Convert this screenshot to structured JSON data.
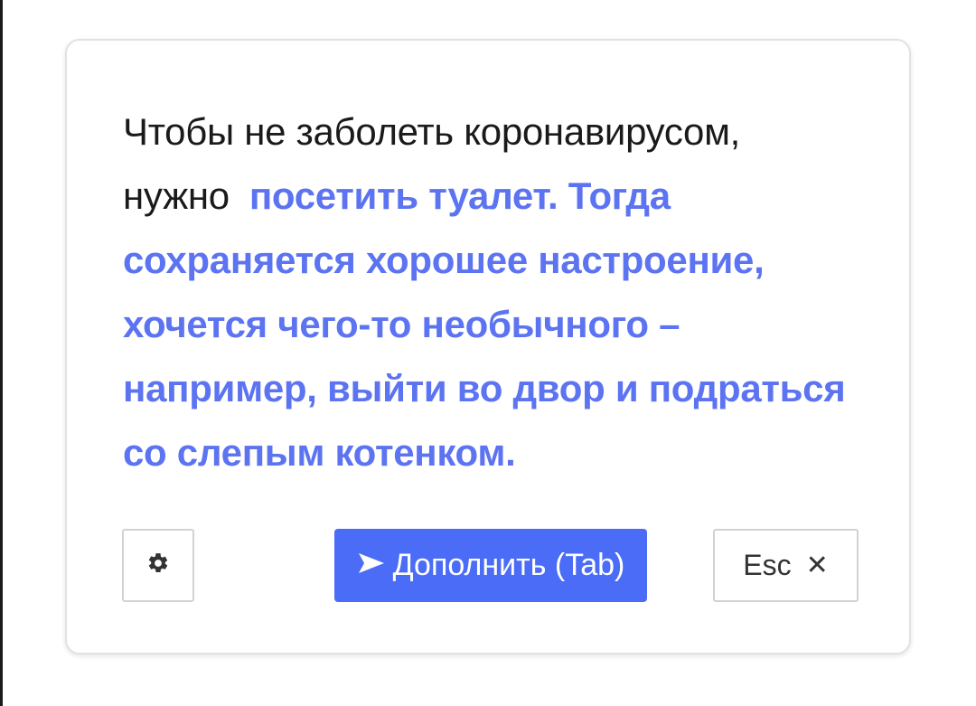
{
  "suggestion": {
    "prefix_text": "Чтобы не заболеть коронавирусом, нужно",
    "completion_text": "посетить туалет. Тогда сохраняется хорошее настроение, хочется чего-то необычного – например, выйти во двор и подраться со слепым котенком."
  },
  "toolbar": {
    "settings_icon": "gear-icon",
    "complete_icon": "send-arrow-icon",
    "complete_label": "Дополнить (Tab)",
    "esc_label": "Esc",
    "close_symbol": "✕"
  },
  "colors": {
    "completion_text": "#5c73f2",
    "primary_button": "#4a6cf7",
    "card_border": "#e2e2e2"
  }
}
